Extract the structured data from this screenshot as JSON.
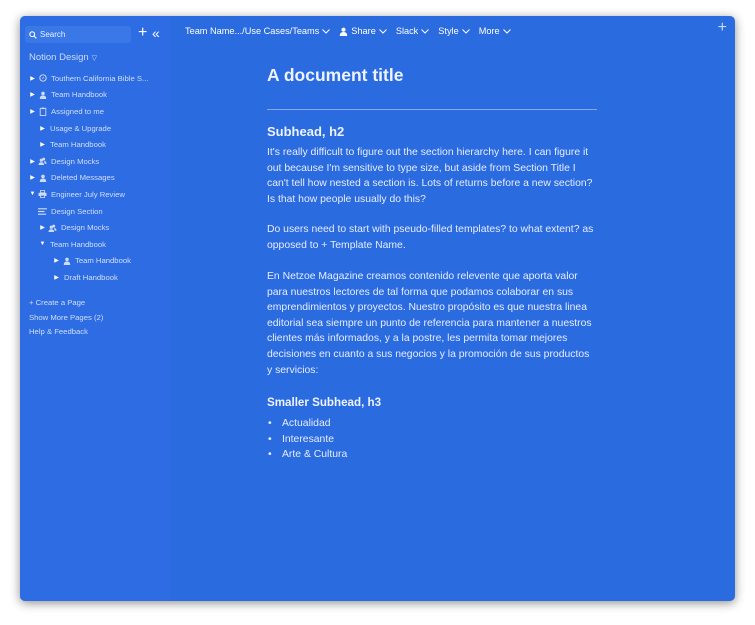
{
  "sidebar": {
    "search_placeholder": "Search",
    "new_page_symbol": "+",
    "collapse_symbol": "«",
    "workspace_name": "Notion Design",
    "items": [
      {
        "label": "Touthern California Bible S...",
        "icon": "compass-icon",
        "expanded": false,
        "level": 0
      },
      {
        "label": "Team Handbook",
        "icon": "person-icon",
        "expanded": false,
        "level": 0
      },
      {
        "label": "Assigned to me",
        "icon": "clipboard-icon",
        "expanded": false,
        "level": 0
      },
      {
        "label": "Usage & Upgrade",
        "icon": "",
        "expanded": false,
        "level": 1
      },
      {
        "label": "Team Handbook",
        "icon": "",
        "expanded": false,
        "level": 1
      },
      {
        "label": "Design Mocks",
        "icon": "people-icon",
        "expanded": false,
        "level": 0
      },
      {
        "label": "Deleted Messages",
        "icon": "person-icon",
        "expanded": false,
        "level": 0
      },
      {
        "label": "Engineer July Review",
        "icon": "printer-icon",
        "expanded": true,
        "level": 0
      },
      {
        "label": "Design Section",
        "icon": "document-icon",
        "expanded": false,
        "level": 1
      },
      {
        "label": "Design Mocks",
        "icon": "people-icon",
        "expanded": false,
        "level": 1
      },
      {
        "label": "Team Handbook",
        "icon": "",
        "expanded": true,
        "level": 1
      },
      {
        "label": "Team Handbook",
        "icon": "person-icon",
        "expanded": false,
        "level": 2
      },
      {
        "label": "Draft Handbook",
        "icon": "",
        "expanded": false,
        "level": 2
      }
    ],
    "add_page": "+ Create a Page",
    "show_more": "Show More Pages (2)",
    "help": "Help & Feedback"
  },
  "topbar": {
    "breadcrumb": "Team Name.../Use Cases/Teams",
    "share": "Share",
    "slack": "Slack",
    "style": "Style",
    "more": "More",
    "add_symbol": "+"
  },
  "document": {
    "title": "A document title",
    "h2": "Subhead, h2",
    "p1": "It's really difficult to figure out the section hierarchy here. I can figure it out because I'm sensitive to type size, but aside from Section Title I can't tell how nested a section is. Lots of returns before a new section? Is that how people usually do this?",
    "p2": "Do users need to start with pseudo-filled templates? to what extent? as opposed to + Template Name.",
    "p3": "En Netzoe Magazine creamos contenido relevente que aporta valor para nuestros lectores de tal forma que podamos colaborar en sus emprendimientos y proyectos. Nuestro propósito es que nuestra linea editorial sea siempre un punto de referencia para mantener a nuestros clientes más informados, y a la postre, les permita tomar mejores decisiones en cuanto a sus negocios y la promoción de sus productos y servicios:",
    "h3": "Smaller Subhead, h3",
    "bullets": [
      "Actualidad",
      "Interesante",
      "Arte & Cultura"
    ]
  },
  "colors": {
    "background": "#2b6be0",
    "sidebar": "#2d6ce2",
    "text": "#eef3ff"
  }
}
